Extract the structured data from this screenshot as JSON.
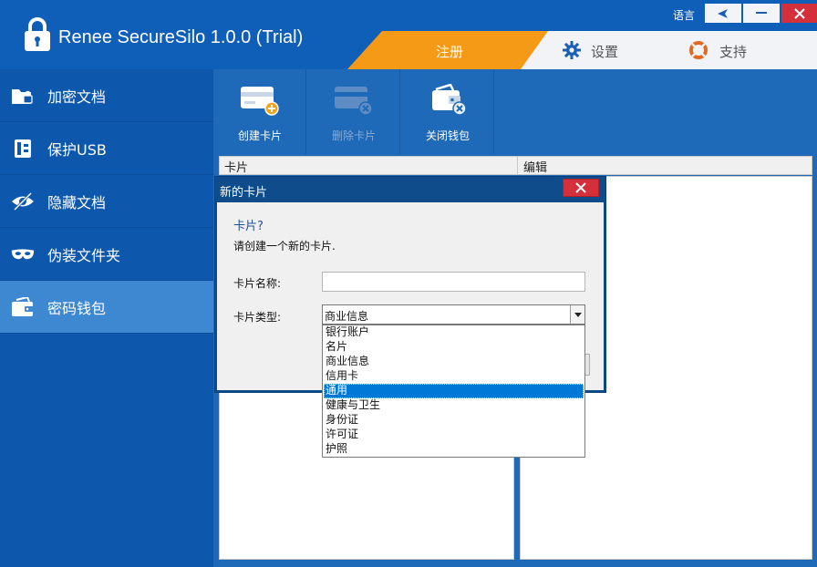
{
  "app": {
    "title": "Renee SecureSilo 1.0.0 (Trial)",
    "lang_label": "语言",
    "lock_icon": "lock-icon"
  },
  "top_tabs": [
    {
      "label": "注册",
      "icon": "none",
      "active": true,
      "accent": "#f59a17"
    },
    {
      "label": "设置",
      "icon": "gear-icon"
    },
    {
      "label": "支持",
      "icon": "lifebuoy-icon"
    }
  ],
  "sidebar": {
    "items": [
      {
        "label": "加密文档",
        "icon": "lock-folder-icon"
      },
      {
        "label": "保护USB",
        "icon": "usb-icon"
      },
      {
        "label": "隐藏文档",
        "icon": "hidden-eye-icon"
      },
      {
        "label": "伪装文件夹",
        "icon": "mask-icon"
      },
      {
        "label": "密码钱包",
        "icon": "wallet-icon",
        "active": true
      }
    ]
  },
  "toolbar": {
    "buttons": [
      {
        "label": "创建卡片",
        "icon": "card-add-icon",
        "enabled": true
      },
      {
        "label": "删除卡片",
        "icon": "card-delete-icon",
        "enabled": false
      },
      {
        "label": "关闭钱包",
        "icon": "wallet-close-icon",
        "enabled": true
      }
    ]
  },
  "list": {
    "columns": [
      "卡片",
      "编辑"
    ]
  },
  "dialog": {
    "title": "新的卡片",
    "heading": "卡片?",
    "description": "请创建一个新的卡片.",
    "name_label": "卡片名称:",
    "name_value": "",
    "type_label": "卡片类型:",
    "type_value": "商业信息",
    "type_options": [
      "银行账户",
      "名片",
      "商业信息",
      "信用卡",
      "通用",
      "健康与卫生",
      "身份证",
      "许可证",
      "护照"
    ],
    "highlighted_option": "通用"
  },
  "colors": {
    "titlebar": "#0f5eb8",
    "sidebar": "#0d57ad",
    "sidebar_active": "#3e87d1",
    "accent": "#f59a17",
    "close": "#d4303b"
  }
}
